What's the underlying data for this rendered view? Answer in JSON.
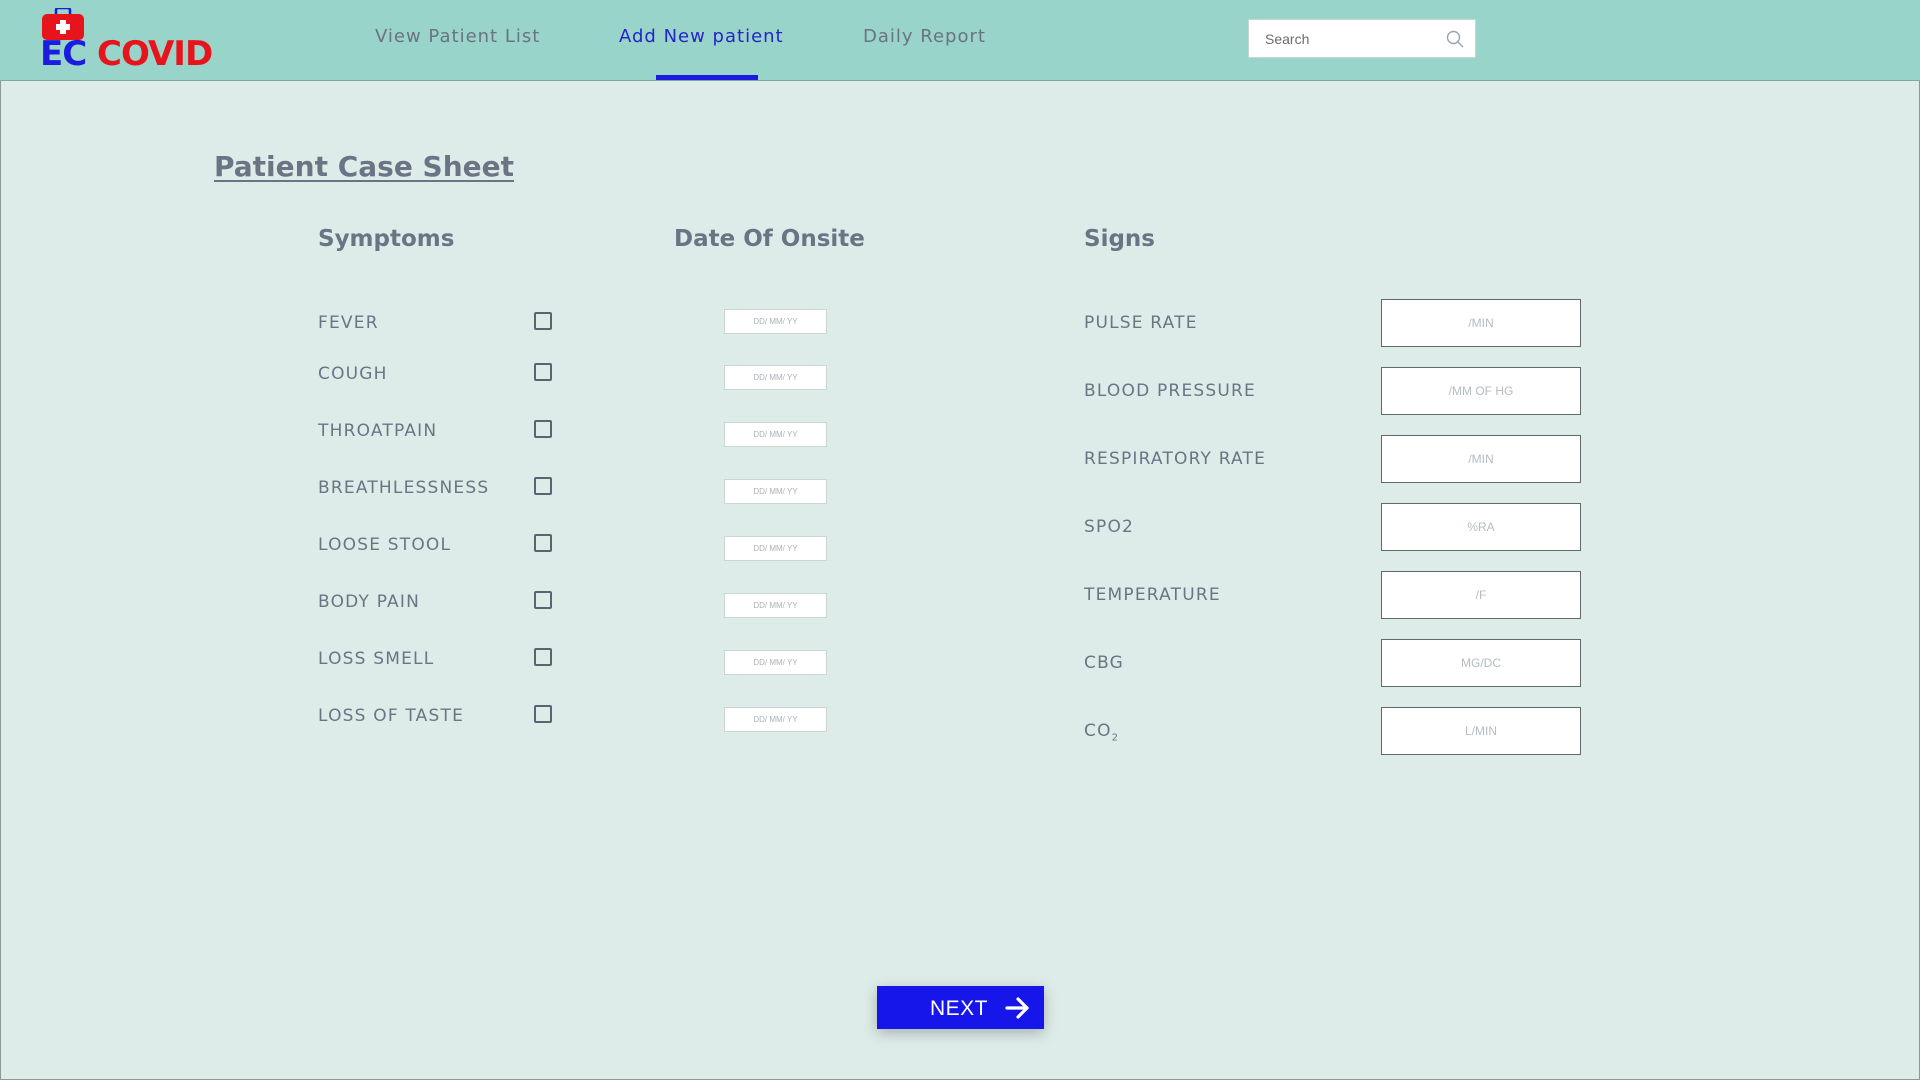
{
  "brand": {
    "ec": "EC",
    "covid": "COVID",
    "bag_color": "#e8141b",
    "ec_color": "#1c1ce0"
  },
  "nav": {
    "items": [
      {
        "label": "View Patient List",
        "active": false
      },
      {
        "label": "Add New patient",
        "active": true
      },
      {
        "label": "Daily Report",
        "active": false
      }
    ]
  },
  "search": {
    "placeholder": "Search",
    "icon": "search-icon"
  },
  "page": {
    "title": "Patient Case Sheet"
  },
  "columns": {
    "symptoms": "Symptoms",
    "date": "Date Of Onsite",
    "signs": "Signs"
  },
  "symptoms": [
    {
      "label": "FEVER",
      "date_placeholder": "DD/ MM/ YY"
    },
    {
      "label": "COUGH",
      "date_placeholder": "DD/ MM/ YY"
    },
    {
      "label": "THROATPAIN",
      "date_placeholder": "DD/ MM/ YY"
    },
    {
      "label": "BREATHLESSNESS",
      "date_placeholder": "DD/ MM/ YY"
    },
    {
      "label": "LOOSE STOOL",
      "date_placeholder": "DD/ MM/ YY"
    },
    {
      "label": "BODY PAIN",
      "date_placeholder": "DD/ MM/ YY"
    },
    {
      "label": "LOSS SMELL",
      "date_placeholder": "DD/ MM/ YY"
    },
    {
      "label": "LOSS OF TASTE",
      "date_placeholder": "DD/ MM/ YY"
    }
  ],
  "signs": [
    {
      "label": "PULSE RATE",
      "placeholder": "/MIN"
    },
    {
      "label": "BLOOD PRESSURE",
      "placeholder": "/MM OF HG"
    },
    {
      "label": "RESPIRATORY RATE",
      "placeholder": "/MIN"
    },
    {
      "label": "SPO2",
      "placeholder": "%RA"
    },
    {
      "label": "TEMPERATURE",
      "placeholder": "/F"
    },
    {
      "label": "CBG",
      "placeholder": "MG/DC"
    },
    {
      "label": "CO",
      "sub": "2",
      "placeholder": "L/MIN"
    }
  ],
  "actions": {
    "next_label": "NEXT",
    "next_color": "#1616ea"
  }
}
